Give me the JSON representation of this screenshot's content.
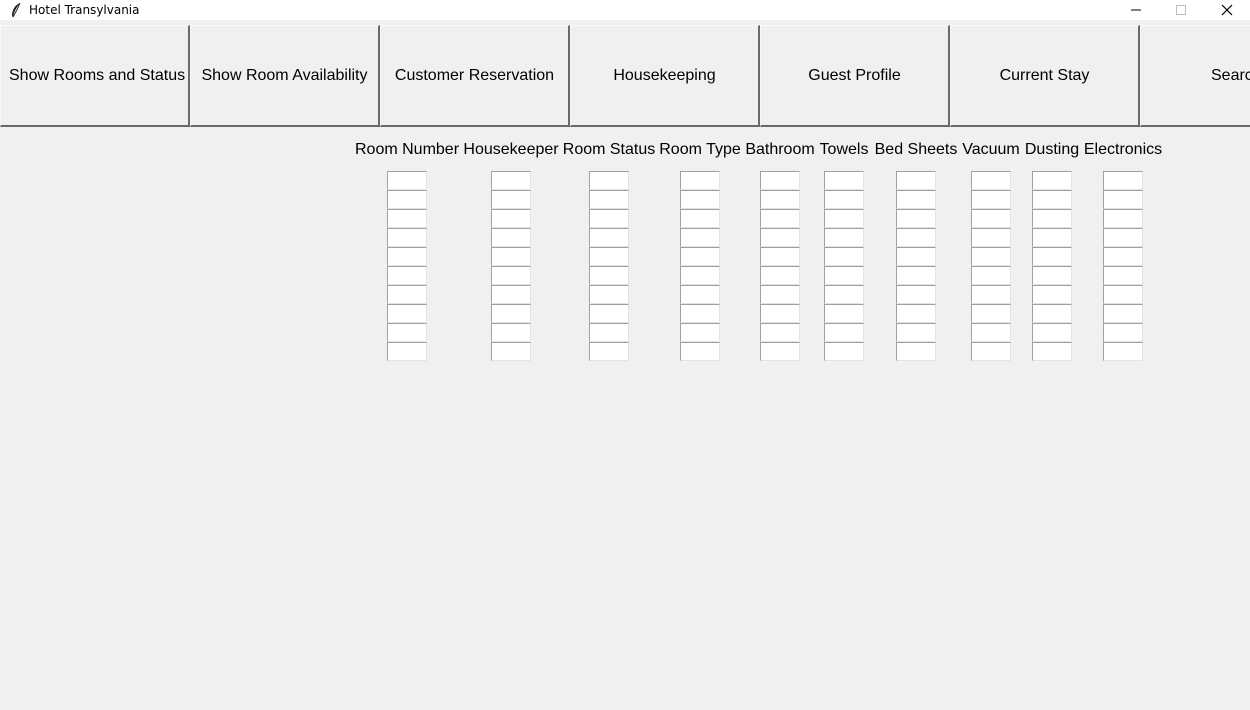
{
  "window": {
    "title": "Hotel Transylvania",
    "app_icon": "feather-icon",
    "controls": [
      "minimize-icon",
      "maximize-icon",
      "close-icon"
    ]
  },
  "toolbar": {
    "buttons": [
      {
        "label": "Show Rooms and Status"
      },
      {
        "label": "Show Room Availability"
      },
      {
        "label": "Customer Reservation"
      },
      {
        "label": "Housekeeping"
      },
      {
        "label": "Guest Profile"
      },
      {
        "label": "Current Stay"
      },
      {
        "label": "Search"
      }
    ]
  },
  "table": {
    "columns": [
      {
        "header": "Room Number"
      },
      {
        "header": "Housekeeper"
      },
      {
        "header": "Room Status"
      },
      {
        "header": "Room Type"
      },
      {
        "header": "Bathroom"
      },
      {
        "header": "Towels"
      },
      {
        "header": "Bed Sheets"
      },
      {
        "header": "Vacuum"
      },
      {
        "header": "Dusting"
      },
      {
        "header": "Electronics"
      }
    ],
    "rows": [
      [
        "",
        "",
        "",
        "",
        "",
        "",
        "",
        "",
        "",
        ""
      ],
      [
        "",
        "",
        "",
        "",
        "",
        "",
        "",
        "",
        "",
        ""
      ],
      [
        "",
        "",
        "",
        "",
        "",
        "",
        "",
        "",
        "",
        ""
      ],
      [
        "",
        "",
        "",
        "",
        "",
        "",
        "",
        "",
        "",
        ""
      ],
      [
        "",
        "",
        "",
        "",
        "",
        "",
        "",
        "",
        "",
        ""
      ],
      [
        "",
        "",
        "",
        "",
        "",
        "",
        "",
        "",
        "",
        ""
      ],
      [
        "",
        "",
        "",
        "",
        "",
        "",
        "",
        "",
        "",
        ""
      ],
      [
        "",
        "",
        "",
        "",
        "",
        "",
        "",
        "",
        "",
        ""
      ],
      [
        "",
        "",
        "",
        "",
        "",
        "",
        "",
        "",
        "",
        ""
      ],
      [
        "",
        "",
        "",
        "",
        "",
        "",
        "",
        "",
        "",
        ""
      ]
    ]
  }
}
